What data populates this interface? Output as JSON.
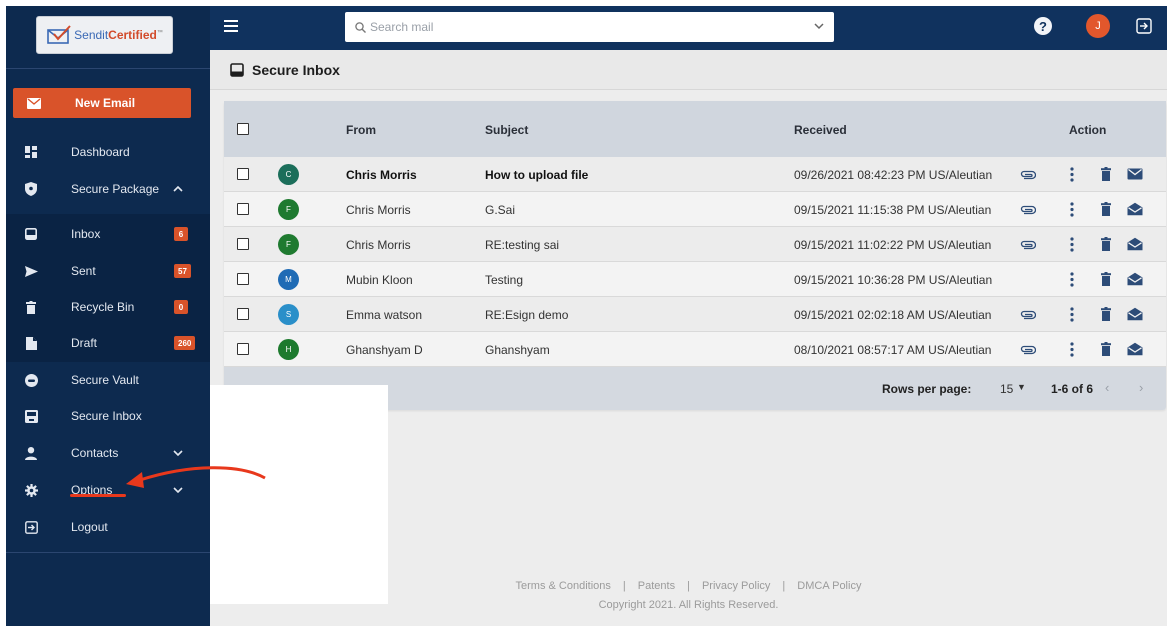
{
  "app": {
    "logo_text_a": "Sendit",
    "logo_text_b": "Certified",
    "logo_tm": "™"
  },
  "sidebar": {
    "new_email": "New Email",
    "items": [
      {
        "label": "Dashboard",
        "icon": "dashboard-icon"
      },
      {
        "label": "Secure Package",
        "icon": "shield-icon",
        "expanded": true
      },
      {
        "label": "Inbox",
        "icon": "inbox-icon",
        "badge": "6"
      },
      {
        "label": "Sent",
        "icon": "send-icon",
        "badge": "57"
      },
      {
        "label": "Recycle Bin",
        "icon": "trash-icon",
        "badge": "0"
      },
      {
        "label": "Draft",
        "icon": "draft-icon",
        "badge": "260"
      },
      {
        "label": "Secure Vault",
        "icon": "vault-icon"
      },
      {
        "label": "Secure Inbox",
        "icon": "secure-inbox-icon"
      },
      {
        "label": "Contacts",
        "icon": "person-icon"
      },
      {
        "label": "Options",
        "icon": "gear-icon"
      },
      {
        "label": "Logout",
        "icon": "logout-icon"
      }
    ]
  },
  "header": {
    "search_placeholder": "Search mail",
    "help": "?",
    "avatar_initial": "J"
  },
  "main": {
    "title": "Secure Inbox",
    "columns": {
      "from": "From",
      "subject": "Subject",
      "received": "Received",
      "action": "Action"
    },
    "rows": [
      {
        "initial": "C",
        "avatar_color": "#1b6e5a",
        "from": "Chris Morris",
        "subject": "How to upload file",
        "received": "09/26/2021 08:42:23 PM US/Aleutian",
        "attachment": true,
        "unread": true
      },
      {
        "initial": "F",
        "avatar_color": "#1f7a30",
        "from": "Chris Morris",
        "subject": "G.Sai",
        "received": "09/15/2021 11:15:38 PM US/Aleutian",
        "attachment": true,
        "unread": false
      },
      {
        "initial": "F",
        "avatar_color": "#1f7a30",
        "from": "Chris Morris",
        "subject": "RE:testing sai",
        "received": "09/15/2021 11:02:22 PM US/Aleutian",
        "attachment": true,
        "unread": false
      },
      {
        "initial": "M",
        "avatar_color": "#1f6bb5",
        "from": "Mubin Kloon",
        "subject": "Testing",
        "received": "09/15/2021 10:36:28 PM US/Aleutian",
        "attachment": false,
        "unread": false
      },
      {
        "initial": "S",
        "avatar_color": "#2a8fc9",
        "from": "Emma watson",
        "subject": "RE:Esign demo",
        "received": "09/15/2021 02:02:18 AM US/Aleutian",
        "attachment": true,
        "unread": false
      },
      {
        "initial": "H",
        "avatar_color": "#1d7a2e",
        "from": "Ghanshyam D",
        "subject": "Ghanshyam",
        "received": "08/10/2021 08:57:17 AM US/Aleutian",
        "attachment": true,
        "unread": false
      }
    ],
    "pagination": {
      "rows_per_page_label": "Rows per page:",
      "rows_per_page": "15",
      "range": "1-6 of 6",
      "prev": "‹",
      "next": "›"
    }
  },
  "footer": {
    "links": [
      "Terms & Conditions",
      "Patents",
      "Privacy Policy",
      "DMCA Policy"
    ],
    "separator": "|",
    "copyright": "Copyright 2021. All Rights Reserved."
  },
  "colors": {
    "sidebar": "#0d2a4f",
    "topbar": "#10325e",
    "accent": "#d9532a",
    "annotation": "#e8381c"
  }
}
